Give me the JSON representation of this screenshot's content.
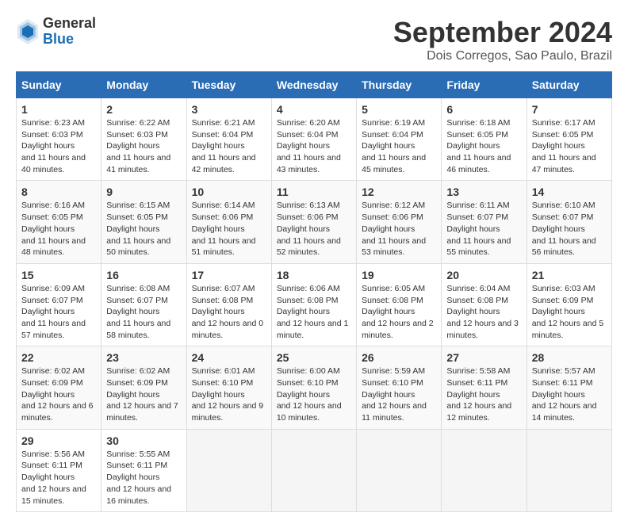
{
  "header": {
    "logo": {
      "general": "General",
      "blue": "Blue"
    },
    "title": "September 2024",
    "location": "Dois Corregos, Sao Paulo, Brazil"
  },
  "calendar": {
    "days_of_week": [
      "Sunday",
      "Monday",
      "Tuesday",
      "Wednesday",
      "Thursday",
      "Friday",
      "Saturday"
    ],
    "weeks": [
      [
        {
          "day": "1",
          "sunrise": "6:23 AM",
          "sunset": "6:03 PM",
          "daylight": "11 hours and 40 minutes."
        },
        {
          "day": "2",
          "sunrise": "6:22 AM",
          "sunset": "6:03 PM",
          "daylight": "11 hours and 41 minutes."
        },
        {
          "day": "3",
          "sunrise": "6:21 AM",
          "sunset": "6:04 PM",
          "daylight": "11 hours and 42 minutes."
        },
        {
          "day": "4",
          "sunrise": "6:20 AM",
          "sunset": "6:04 PM",
          "daylight": "11 hours and 43 minutes."
        },
        {
          "day": "5",
          "sunrise": "6:19 AM",
          "sunset": "6:04 PM",
          "daylight": "11 hours and 45 minutes."
        },
        {
          "day": "6",
          "sunrise": "6:18 AM",
          "sunset": "6:05 PM",
          "daylight": "11 hours and 46 minutes."
        },
        {
          "day": "7",
          "sunrise": "6:17 AM",
          "sunset": "6:05 PM",
          "daylight": "11 hours and 47 minutes."
        }
      ],
      [
        {
          "day": "8",
          "sunrise": "6:16 AM",
          "sunset": "6:05 PM",
          "daylight": "11 hours and 48 minutes."
        },
        {
          "day": "9",
          "sunrise": "6:15 AM",
          "sunset": "6:05 PM",
          "daylight": "11 hours and 50 minutes."
        },
        {
          "day": "10",
          "sunrise": "6:14 AM",
          "sunset": "6:06 PM",
          "daylight": "11 hours and 51 minutes."
        },
        {
          "day": "11",
          "sunrise": "6:13 AM",
          "sunset": "6:06 PM",
          "daylight": "11 hours and 52 minutes."
        },
        {
          "day": "12",
          "sunrise": "6:12 AM",
          "sunset": "6:06 PM",
          "daylight": "11 hours and 53 minutes."
        },
        {
          "day": "13",
          "sunrise": "6:11 AM",
          "sunset": "6:07 PM",
          "daylight": "11 hours and 55 minutes."
        },
        {
          "day": "14",
          "sunrise": "6:10 AM",
          "sunset": "6:07 PM",
          "daylight": "11 hours and 56 minutes."
        }
      ],
      [
        {
          "day": "15",
          "sunrise": "6:09 AM",
          "sunset": "6:07 PM",
          "daylight": "11 hours and 57 minutes."
        },
        {
          "day": "16",
          "sunrise": "6:08 AM",
          "sunset": "6:07 PM",
          "daylight": "11 hours and 58 minutes."
        },
        {
          "day": "17",
          "sunrise": "6:07 AM",
          "sunset": "6:08 PM",
          "daylight": "12 hours and 0 minutes."
        },
        {
          "day": "18",
          "sunrise": "6:06 AM",
          "sunset": "6:08 PM",
          "daylight": "12 hours and 1 minute."
        },
        {
          "day": "19",
          "sunrise": "6:05 AM",
          "sunset": "6:08 PM",
          "daylight": "12 hours and 2 minutes."
        },
        {
          "day": "20",
          "sunrise": "6:04 AM",
          "sunset": "6:08 PM",
          "daylight": "12 hours and 3 minutes."
        },
        {
          "day": "21",
          "sunrise": "6:03 AM",
          "sunset": "6:09 PM",
          "daylight": "12 hours and 5 minutes."
        }
      ],
      [
        {
          "day": "22",
          "sunrise": "6:02 AM",
          "sunset": "6:09 PM",
          "daylight": "12 hours and 6 minutes."
        },
        {
          "day": "23",
          "sunrise": "6:02 AM",
          "sunset": "6:09 PM",
          "daylight": "12 hours and 7 minutes."
        },
        {
          "day": "24",
          "sunrise": "6:01 AM",
          "sunset": "6:10 PM",
          "daylight": "12 hours and 9 minutes."
        },
        {
          "day": "25",
          "sunrise": "6:00 AM",
          "sunset": "6:10 PM",
          "daylight": "12 hours and 10 minutes."
        },
        {
          "day": "26",
          "sunrise": "5:59 AM",
          "sunset": "6:10 PM",
          "daylight": "12 hours and 11 minutes."
        },
        {
          "day": "27",
          "sunrise": "5:58 AM",
          "sunset": "6:11 PM",
          "daylight": "12 hours and 12 minutes."
        },
        {
          "day": "28",
          "sunrise": "5:57 AM",
          "sunset": "6:11 PM",
          "daylight": "12 hours and 14 minutes."
        }
      ],
      [
        {
          "day": "29",
          "sunrise": "5:56 AM",
          "sunset": "6:11 PM",
          "daylight": "12 hours and 15 minutes."
        },
        {
          "day": "30",
          "sunrise": "5:55 AM",
          "sunset": "6:11 PM",
          "daylight": "12 hours and 16 minutes."
        },
        null,
        null,
        null,
        null,
        null
      ]
    ]
  }
}
